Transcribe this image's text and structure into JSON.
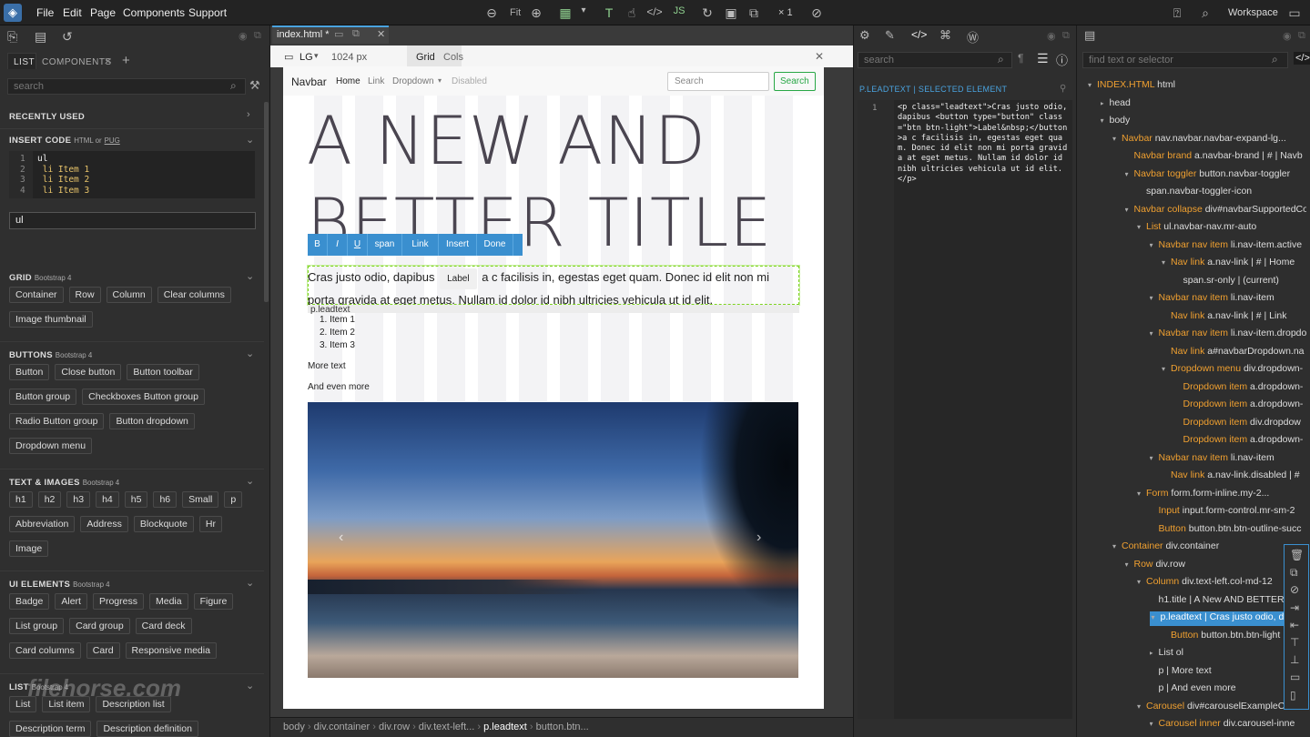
{
  "menu": [
    "File",
    "Edit",
    "Page",
    "Components",
    "Support"
  ],
  "topbar": {
    "zoom": "Fit",
    "multiplier": "× 1",
    "workspace": "Workspace"
  },
  "left": {
    "tabs": [
      "LIST",
      "COMPONENTS"
    ],
    "search_placeholder": "search",
    "recently_used": "RECENTLY USED",
    "insert_code": "INSERT CODE",
    "insert_code_sub": "HTML or",
    "insert_code_pug": "PUG",
    "code_lines": [
      {
        "n": "1",
        "t": "ul"
      },
      {
        "n": "2",
        "t": " li Item 1"
      },
      {
        "n": "3",
        "t": " li Item 2"
      },
      {
        "n": "4",
        "t": " li Item 3"
      }
    ],
    "code_input": "ul",
    "sections": [
      {
        "title": "GRID",
        "sub": "Bootstrap 4",
        "rows": [
          [
            "Container",
            "Row",
            "Column",
            "Clear columns"
          ],
          [
            "Image thumbnail"
          ]
        ]
      },
      {
        "title": "BUTTONS",
        "sub": "Bootstrap 4",
        "rows": [
          [
            "Button",
            "Close button",
            "Button toolbar"
          ],
          [
            "Button group",
            "Checkboxes Button group"
          ],
          [
            "Radio Button group",
            "Button dropdown"
          ],
          [
            "Dropdown menu"
          ]
        ]
      },
      {
        "title": "TEXT & IMAGES",
        "sub": "Bootstrap 4",
        "rows": [
          [
            "h1",
            "h2",
            "h3",
            "h4",
            "h5",
            "h6",
            "Small",
            "p"
          ],
          [
            "Abbreviation",
            "Address",
            "Blockquote",
            "Hr"
          ],
          [
            "Image"
          ]
        ]
      },
      {
        "title": "UI ELEMENTS",
        "sub": "Bootstrap 4",
        "rows": [
          [
            "Badge",
            "Alert",
            "Progress",
            "Media",
            "Figure"
          ],
          [
            "List group",
            "Card group",
            "Card deck"
          ],
          [
            "Card columns",
            "Card",
            "Responsive media"
          ]
        ]
      },
      {
        "title": "LIST",
        "sub": "Bootstrap 4",
        "rows": [
          [
            "List",
            "List item",
            "Description list"
          ],
          [
            "Description term",
            "Description definition"
          ]
        ]
      }
    ]
  },
  "doc": {
    "tab": "index.html *",
    "device": "LG",
    "width": "1024 px",
    "grid": "Grid",
    "cols": "Cols"
  },
  "page": {
    "brand": "Navbar",
    "nav": [
      "Home",
      "Link",
      "Dropdown",
      "Disabled"
    ],
    "search_ph": "Search",
    "search_btn": "Search",
    "title": "A NEW AND BETTER TITLE",
    "toolbar": [
      "B",
      "I",
      "U",
      "span",
      "Link",
      "Insert",
      "Done"
    ],
    "lead_a": "Cras justo odio, dapibus",
    "lead_label": "Label",
    "lead_b": "a c facilisis in, egestas eget quam. Donec id elit non mi porta gravida at eget metus. Nullam id dolor id nibh ultricies vehicula ut id elit.",
    "tag": "p.leadtext",
    "items": [
      "1. Item 1",
      "2. Item 2",
      "3. Item 3"
    ],
    "more": "More text",
    "even_more": "And even more"
  },
  "breadcrumb": [
    "body",
    "div.container",
    "div.row",
    "div.text-left...",
    "p.leadtext",
    "button.btn..."
  ],
  "code": {
    "search_ph": "search",
    "header": "P.LEADTEXT | SELECTED ELEMENT",
    "line": "1",
    "source": "<p class=\"leadtext\">Cras justo odio, dapibus <button type=\"button\" class=\"btn btn-light\">Label&nbsp;</button>a c facilisis in, egestas eget quam. Donec id elit non mi porta gravida at eget metus. Nullam id dolor id nibh ultricies vehicula ut id elit.</p>"
  },
  "tree": {
    "search_ph": "find text or selector",
    "nodes": [
      {
        "d": 0,
        "t": "▾",
        "o": "INDEX.HTML",
        "w": "html"
      },
      {
        "d": 1,
        "t": "▸",
        "o": "",
        "w": "head"
      },
      {
        "d": 1,
        "t": "▾",
        "o": "",
        "w": "body"
      },
      {
        "d": 2,
        "t": "▾",
        "o": "Navbar",
        "w": "nav.navbar.navbar-expand-lg..."
      },
      {
        "d": 3,
        "t": "",
        "o": "Navbar brand",
        "w": "a.navbar-brand | # | Navb"
      },
      {
        "d": 3,
        "t": "▾",
        "o": "Navbar toggler",
        "w": "button.navbar-toggler"
      },
      {
        "d": 4,
        "t": "",
        "o": "",
        "w": "span.navbar-toggler-icon"
      },
      {
        "d": 3,
        "t": "▾",
        "o": "Navbar collapse",
        "w": "div#navbarSupportedCo"
      },
      {
        "d": 4,
        "t": "▾",
        "o": "List",
        "w": "ul.navbar-nav.mr-auto"
      },
      {
        "d": 5,
        "t": "▾",
        "o": "Navbar nav item",
        "w": "li.nav-item.active"
      },
      {
        "d": 6,
        "t": "▾",
        "o": "Nav link",
        "w": "a.nav-link | # | Home"
      },
      {
        "d": 7,
        "t": "",
        "o": "",
        "w": "span.sr-only | (current)"
      },
      {
        "d": 5,
        "t": "▾",
        "o": "Navbar nav item",
        "w": "li.nav-item"
      },
      {
        "d": 6,
        "t": "",
        "o": "Nav link",
        "w": "a.nav-link | # | Link"
      },
      {
        "d": 5,
        "t": "▾",
        "o": "Navbar nav item",
        "w": "li.nav-item.dropdo"
      },
      {
        "d": 6,
        "t": "",
        "o": "Nav link",
        "w": "a#navbarDropdown.na"
      },
      {
        "d": 6,
        "t": "▾",
        "o": "Dropdown menu",
        "w": "div.dropdown-"
      },
      {
        "d": 7,
        "t": "",
        "o": "Dropdown item",
        "w": "a.dropdown-"
      },
      {
        "d": 7,
        "t": "",
        "o": "Dropdown item",
        "w": "a.dropdown-"
      },
      {
        "d": 7,
        "t": "",
        "o": "Dropdown item",
        "w": "div.dropdow"
      },
      {
        "d": 7,
        "t": "",
        "o": "Dropdown item",
        "w": "a.dropdown-"
      },
      {
        "d": 5,
        "t": "▾",
        "o": "Navbar nav item",
        "w": "li.nav-item"
      },
      {
        "d": 6,
        "t": "",
        "o": "Nav link",
        "w": "a.nav-link.disabled | #"
      },
      {
        "d": 4,
        "t": "▾",
        "o": "Form",
        "w": "form.form-inline.my-2..."
      },
      {
        "d": 5,
        "t": "",
        "o": "Input",
        "w": "input.form-control.mr-sm-2"
      },
      {
        "d": 5,
        "t": "",
        "o": "Button",
        "w": "button.btn.btn-outline-succ"
      },
      {
        "d": 2,
        "t": "▾",
        "o": "Container",
        "w": "div.container"
      },
      {
        "d": 3,
        "t": "▾",
        "o": "Row",
        "w": "div.row"
      },
      {
        "d": 4,
        "t": "▾",
        "o": "Column",
        "w": "div.text-left.col-md-12"
      },
      {
        "d": 5,
        "t": "",
        "o": "",
        "w": "h1.title | A New AND BETTER"
      },
      {
        "d": 5,
        "t": "▾",
        "o": "",
        "w": "p.leadtext | Cras justo odio, d",
        "sel": true
      },
      {
        "d": 6,
        "t": "",
        "o": "Button",
        "w": "button.btn.btn-light"
      },
      {
        "d": 5,
        "t": "▸",
        "o": "",
        "w": "List ol"
      },
      {
        "d": 5,
        "t": "",
        "o": "",
        "w": "p | More text"
      },
      {
        "d": 5,
        "t": "",
        "o": "",
        "w": "p | And even more"
      },
      {
        "d": 4,
        "t": "▾",
        "o": "Carousel",
        "w": "div#carouselExampleCo"
      },
      {
        "d": 5,
        "t": "▾",
        "o": "Carousel inner",
        "w": "div.carousel-inne"
      }
    ]
  },
  "watermark": "filehorse.com"
}
